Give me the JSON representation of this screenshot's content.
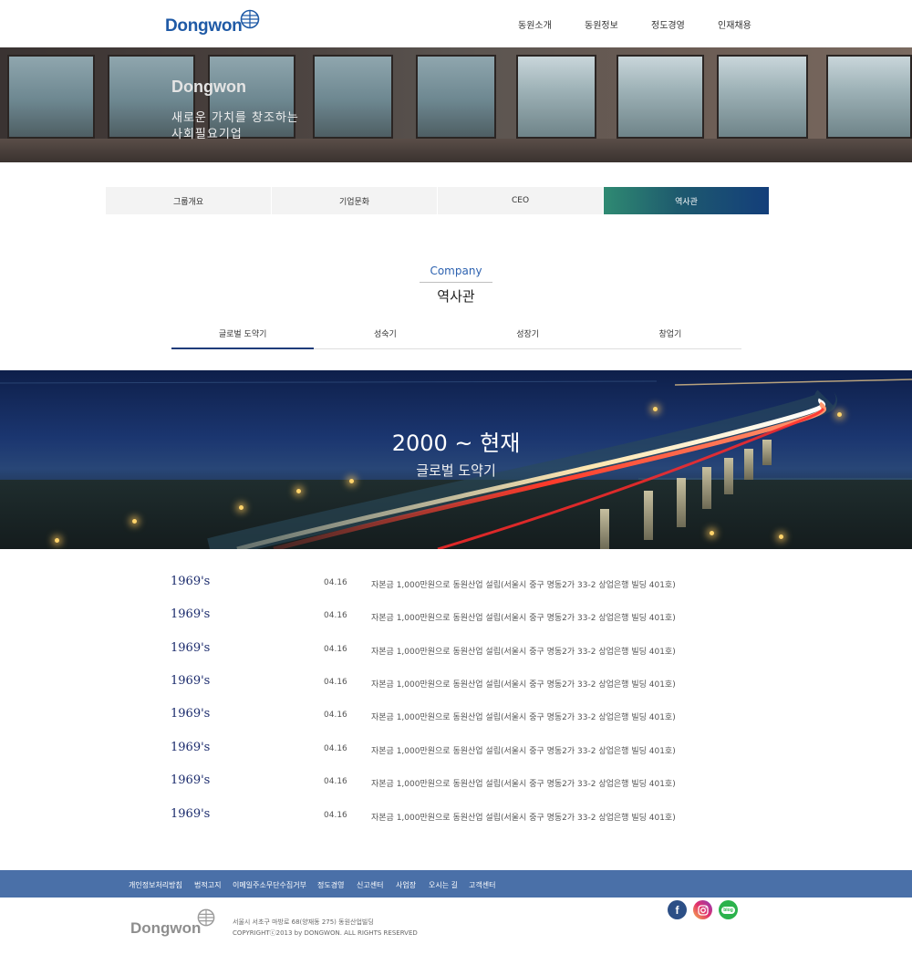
{
  "header": {
    "logo": "Dongwon",
    "nav": [
      "동원소개",
      "동원정보",
      "정도경영",
      "인재채용"
    ]
  },
  "hero": {
    "brand": "Dongwon",
    "line1": "새로운 가치를 창조하는",
    "line2": "사회필요기업"
  },
  "tabs": {
    "items": [
      "그룹개요",
      "기업문화",
      "CEO",
      "역사관"
    ],
    "active": "역사관"
  },
  "section": {
    "subtitle": "Company",
    "title": "역사관"
  },
  "subtabs": {
    "items": [
      "글로벌 도약기",
      "성숙기",
      "성장기",
      "창업기"
    ],
    "active": "글로벌 도약기"
  },
  "era": {
    "years": "2000 ~ 현재",
    "name": "글로벌 도약기"
  },
  "history": [
    {
      "year": "1969's",
      "date": "04.16",
      "desc": "자본금 1,000만원으로 동원산업 설립(서울시 중구 명동2가 33-2 상업은행 빌딩 401호)"
    },
    {
      "year": "1969's",
      "date": "04.16",
      "desc": "자본금 1,000만원으로 동원산업 설립(서울시 중구 명동2가 33-2 상업은행 빌딩 401호)"
    },
    {
      "year": "1969's",
      "date": "04.16",
      "desc": "자본금 1,000만원으로 동원산업 설립(서울시 중구 명동2가 33-2 상업은행 빌딩 401호)"
    },
    {
      "year": "1969's",
      "date": "04.16",
      "desc": "자본금 1,000만원으로 동원산업 설립(서울시 중구 명동2가 33-2 상업은행 빌딩 401호)"
    },
    {
      "year": "1969's",
      "date": "04.16",
      "desc": "자본금 1,000만원으로 동원산업 설립(서울시 중구 명동2가 33-2 상업은행 빌딩 401호)"
    },
    {
      "year": "1969's",
      "date": "04.16",
      "desc": "자본금 1,000만원으로 동원산업 설립(서울시 중구 명동2가 33-2 상업은행 빌딩 401호)"
    },
    {
      "year": "1969's",
      "date": "04.16",
      "desc": "자본금 1,000만원으로 동원산업 설립(서울시 중구 명동2가 33-2 상업은행 빌딩 401호)"
    },
    {
      "year": "1969's",
      "date": "04.16",
      "desc": "자본금 1,000만원으로 동원산업 설립(서울시 중구 명동2가 33-2 상업은행 빌딩 401호)"
    }
  ],
  "footer": {
    "links": [
      "개인정보처리방침",
      "법적고지",
      "이메일주소무단수집거부",
      "정도경영",
      "신고센터",
      "사업장",
      "오시는 길",
      "고객센터"
    ],
    "logo": "Dongwon",
    "address": "서울시 서초구 마방로 68(양재동 275) 동원산업빌딩",
    "copyright": "COPYRIGHTⓒ2013 by DONGWON. ALL RIGHTS RESERVED",
    "social": {
      "facebook_icon": "facebook-icon",
      "instagram_icon": "instagram-icon",
      "blog_icon": "blog-icon",
      "blog_text": "blog"
    }
  },
  "colors": {
    "brand_blue": "#1f5aa6",
    "footer_bar": "#4a70a8",
    "year_navy": "#1a2a6c",
    "active_tab_start": "#2f8a72",
    "active_tab_end": "#133e7a"
  }
}
